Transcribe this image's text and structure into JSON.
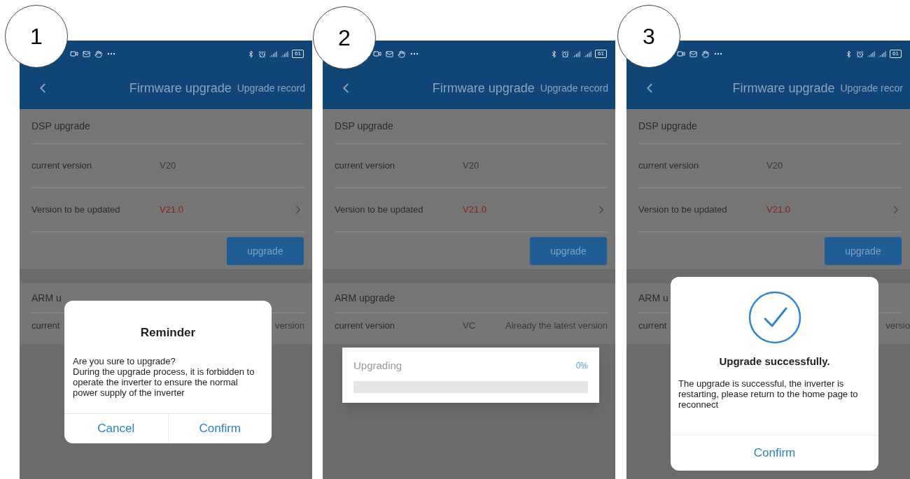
{
  "panels": [
    {
      "step": "1",
      "status_bar": {
        "battery": "61"
      },
      "header": {
        "title": "Firmware upgrade",
        "action": "Upgrade record"
      },
      "dsp": {
        "title": "DSP upgrade",
        "rows": [
          {
            "kind": "info",
            "label": "current version",
            "value": "V20"
          },
          {
            "kind": "link",
            "label": "Version to be updated",
            "value": "V21.0"
          }
        ],
        "button": "upgrade"
      },
      "arm": {
        "title": "ARM u",
        "row": {
          "label": "current",
          "note": "version"
        }
      },
      "dialog": {
        "kind": "confirm",
        "title": "Reminder",
        "lines": [
          "Are you sure to upgrade?",
          "During the upgrade process, it is forbidden to operate the inverter to ensure the normal power supply of the inverter"
        ],
        "buttons": [
          "Cancel",
          "Confirm"
        ]
      }
    },
    {
      "step": "2",
      "status_bar": {
        "battery": "61"
      },
      "header": {
        "title": "Firmware upgrade",
        "action": "Upgrade record"
      },
      "dsp": {
        "title": "DSP upgrade",
        "rows": [
          {
            "kind": "info",
            "label": "current version",
            "value": "V20"
          },
          {
            "kind": "link",
            "label": "Version to be updated",
            "value": "V21.0"
          }
        ],
        "button": "upgrade"
      },
      "arm": {
        "title": "ARM upgrade",
        "row": {
          "label": "current version",
          "value": "VC",
          "note": "Already the latest version"
        }
      },
      "dialog": {
        "kind": "progress",
        "title": "Upgrading",
        "percent": "0%",
        "level": 0
      }
    },
    {
      "step": "3",
      "status_bar": {
        "battery": "61"
      },
      "header": {
        "title": "Firmware upgrade",
        "action": "Upgrade recor"
      },
      "dsp": {
        "title": "DSP upgrade",
        "rows": [
          {
            "kind": "info",
            "label": "current version",
            "value": "V20"
          },
          {
            "kind": "link",
            "label": "Version to be updated",
            "value": "V21.0"
          }
        ],
        "button": "upgrade"
      },
      "arm": {
        "title": "ARM u",
        "row": {
          "label": "current",
          "note": "versio"
        }
      },
      "dialog": {
        "kind": "success",
        "title": "Upgrade successfully.",
        "lines": [
          "The upgrade is successful, the inverter is restarting, please return to the home page to reconnect"
        ],
        "buttons": [
          "Confirm"
        ]
      }
    }
  ]
}
